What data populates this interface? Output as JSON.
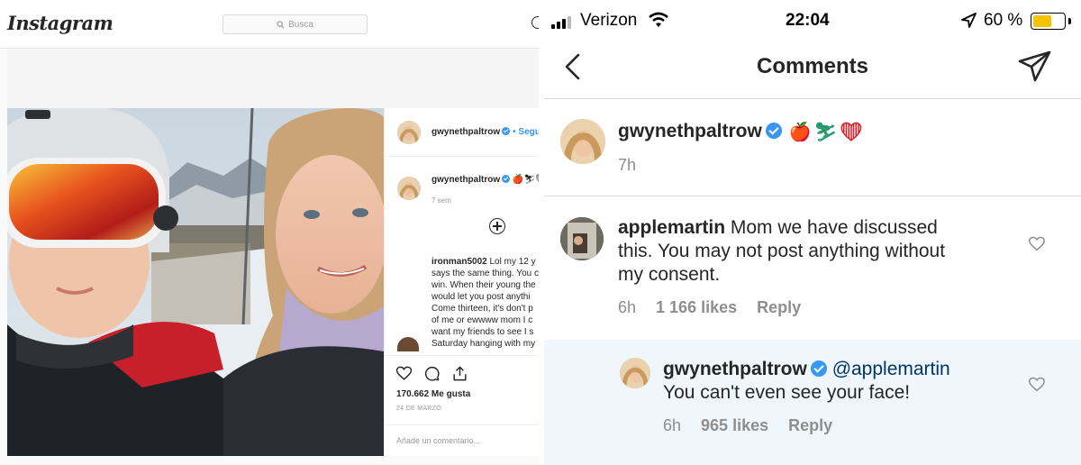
{
  "instagram_web": {
    "logo": "Instagram",
    "search_placeholder": "Busca",
    "post_header": {
      "username": "gwynethpaltrow",
      "follow_label": "• Seguir"
    },
    "caption": {
      "username": "gwynethpaltrow",
      "emojis": "🍎⛷❤",
      "time": "7 sem"
    },
    "comment": {
      "username": "ironman5002",
      "lines": [
        "Lol my 12 y",
        "says the same thing. You c",
        "win. When their young the",
        "would let you post anythi",
        "Come thirteen, it's don't p",
        "of me or ewwww mom I c",
        "want my friends to see I s",
        "Saturday hanging with my"
      ]
    },
    "likes": "170.662 Me gusta",
    "date": "24 DE MARZO",
    "add_comment_placeholder": "Añade un comentario..."
  },
  "ios_app": {
    "status_bar": {
      "carrier": "Verizon",
      "time": "22:04",
      "battery_percent": "60 %",
      "battery_level": 0.6,
      "battery_color": "#f5c400"
    },
    "nav": {
      "title": "Comments"
    },
    "caption": {
      "username": "gwynethpaltrow",
      "emojis": [
        "🍎",
        "⛷",
        "❤"
      ],
      "time": "7h"
    },
    "comments": [
      {
        "username": "applemartin",
        "text_line1": "Mom we have discussed",
        "text_line2": "this. You may not post anything without",
        "text_line3": "my consent.",
        "time": "6h",
        "likes": "1 166 likes",
        "reply_label": "Reply"
      },
      {
        "username": "gwynethpaltrow",
        "mention": "@applemartin",
        "text": "You can't even see your face!",
        "time": "6h",
        "likes": "965 likes",
        "reply_label": "Reply",
        "highlight_color": "#eff7fc"
      }
    ]
  },
  "colors": {
    "verified_blue": "#3897f0",
    "link_blue": "#003569",
    "meta_gray": "#8e8e8e",
    "text_dark": "#262626"
  }
}
